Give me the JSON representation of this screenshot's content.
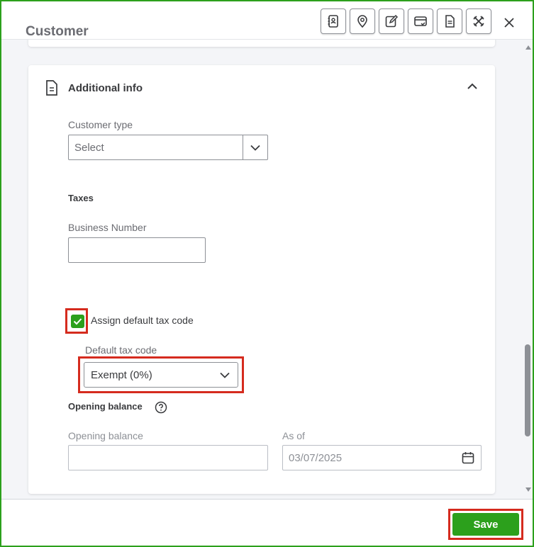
{
  "header": {
    "title": "Customer",
    "toolbar_icons": [
      "address-book-icon",
      "location-pin-icon",
      "edit-icon",
      "payment-card-icon",
      "document-icon",
      "tools-icon"
    ],
    "close_icon": "close-icon"
  },
  "section": {
    "title": "Additional info",
    "icon": "document-icon",
    "collapse_icon": "chevron-up-icon"
  },
  "customer_type": {
    "label": "Customer type",
    "value": "Select"
  },
  "taxes": {
    "heading": "Taxes",
    "business_number_label": "Business Number",
    "business_number_value": "",
    "assign_default_label": "Assign default tax code",
    "assign_default_checked": true,
    "default_tax_code_label": "Default tax code",
    "default_tax_code_value": "Exempt (0%)"
  },
  "opening_balance": {
    "heading": "Opening balance",
    "balance_label": "Opening balance",
    "balance_value": "",
    "as_of_label": "As of",
    "as_of_value": "03/07/2025"
  },
  "footer": {
    "save_label": "Save"
  },
  "colors": {
    "accent_green": "#2ca01c",
    "highlight_red": "#d52b1e",
    "frame_border": "#2ca01c"
  }
}
